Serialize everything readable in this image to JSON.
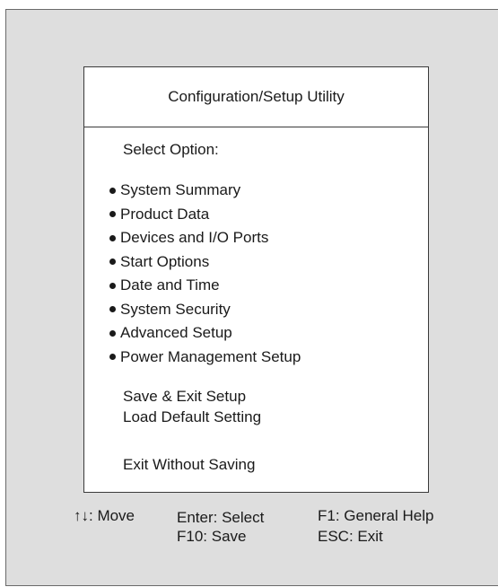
{
  "window": {
    "title": "Configuration/Setup Utility"
  },
  "menu": {
    "select_label": "Select Option:",
    "options": [
      {
        "label": "System Summary"
      },
      {
        "label": "Product Data"
      },
      {
        "label": "Devices and I/O Ports"
      },
      {
        "label": "Start Options"
      },
      {
        "label": "Date and Time"
      },
      {
        "label": "System Security"
      },
      {
        "label": "Advanced Setup"
      },
      {
        "label": "Power Management Setup"
      }
    ],
    "actions": {
      "save_exit": "Save & Exit Setup",
      "load_default": "Load Default Setting",
      "exit_without_saving": "Exit Without Saving"
    }
  },
  "footer": {
    "move": "↑↓: Move",
    "enter": "Enter: Select",
    "f10": "F10: Save",
    "f1": "F1: General Help",
    "esc": "ESC: Exit"
  },
  "colors": {
    "screen_background": "#dedede",
    "menu_background": "#ffffff",
    "text": "#1a1a1a"
  },
  "icons": {
    "bullet": "bullet-icon"
  }
}
